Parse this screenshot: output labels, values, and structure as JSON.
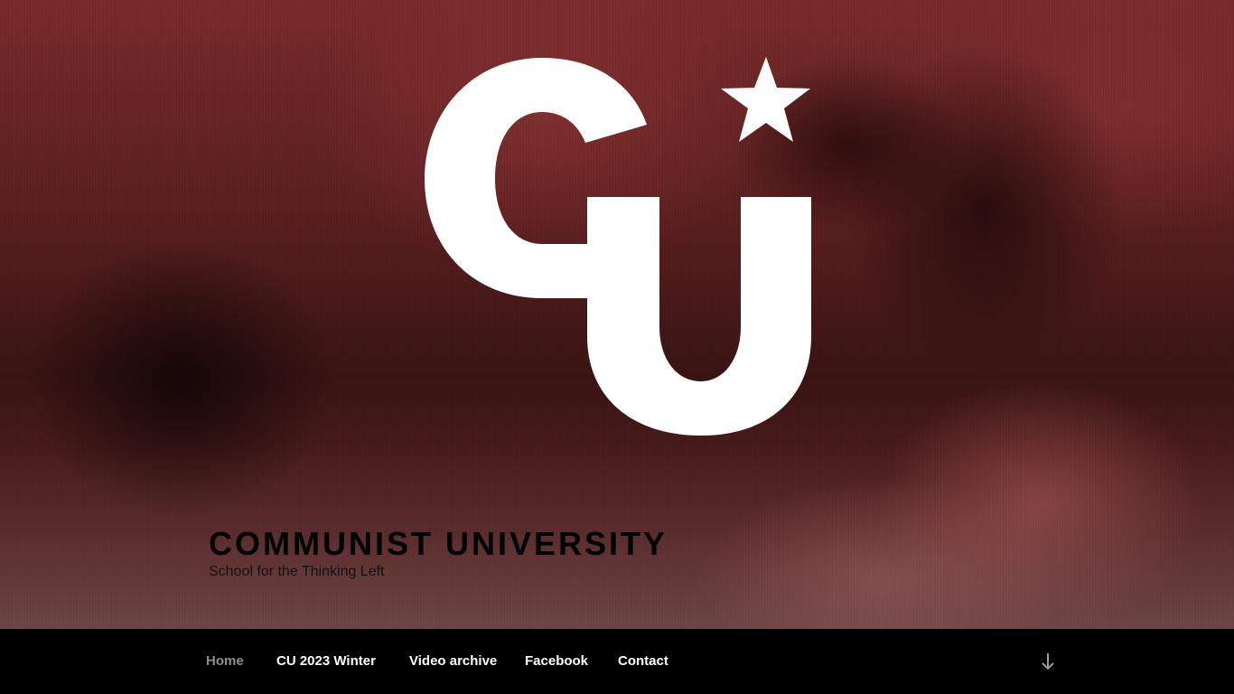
{
  "site": {
    "title": "COMMUNIST UNIVERSITY",
    "tagline": "School for the Thinking Left"
  },
  "logo": {
    "text": "CU",
    "icon": "star-icon",
    "color": "#ffffff"
  },
  "nav": {
    "items": [
      {
        "label": "Home",
        "current": true
      },
      {
        "label": "CU 2023 Winter",
        "current": false
      },
      {
        "label": "Video archive",
        "current": false
      },
      {
        "label": "Facebook",
        "current": false
      },
      {
        "label": "Contact",
        "current": false
      }
    ],
    "scroll_icon": "arrow-down-icon"
  },
  "colors": {
    "nav_background": "#000000",
    "nav_text": "#ffffff",
    "nav_current_text": "#8d8d8d",
    "hero_tint": "#6e2828",
    "title_text": "#000000"
  }
}
